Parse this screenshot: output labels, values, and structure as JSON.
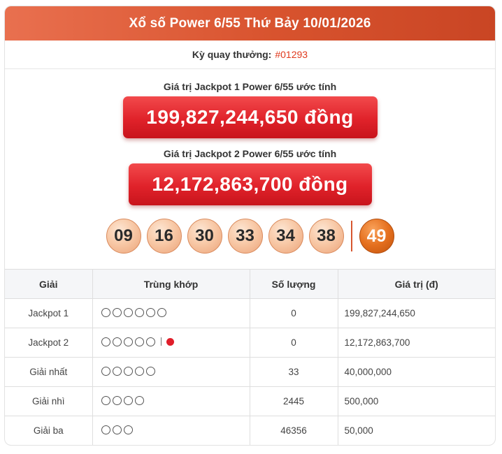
{
  "header": {
    "title": "Xổ số Power 6/55 Thứ Bảy 10/01/2026"
  },
  "draw": {
    "label": "Kỳ quay thưởng:",
    "id": "#01293"
  },
  "jackpot1": {
    "label": "Giá trị Jackpot 1 Power 6/55 ước tính",
    "value": "199,827,244,650 đồng"
  },
  "jackpot2": {
    "label": "Giá trị Jackpot 2 Power 6/55 ước tính",
    "value": "12,172,863,700 đồng"
  },
  "balls": [
    "09",
    "16",
    "30",
    "33",
    "34",
    "38"
  ],
  "power_ball": "49",
  "colors": {
    "header": "#d8532e",
    "jackpot": "#e0222a",
    "value_text": "#e03a1e",
    "power_ball": "#e5701f"
  },
  "table": {
    "headers": [
      "Giải",
      "Trùng khớp",
      "Số lượng",
      "Giá trị (đ)"
    ],
    "rows": [
      {
        "name": "Jackpot 1",
        "match_circles": 6,
        "power": false,
        "qty": "0",
        "value": "199,827,244,650"
      },
      {
        "name": "Jackpot 2",
        "match_circles": 5,
        "power": true,
        "qty": "0",
        "value": "12,172,863,700"
      },
      {
        "name": "Giải nhất",
        "match_circles": 5,
        "power": false,
        "qty": "33",
        "value": "40,000,000"
      },
      {
        "name": "Giải nhì",
        "match_circles": 4,
        "power": false,
        "qty": "2445",
        "value": "500,000"
      },
      {
        "name": "Giải ba",
        "match_circles": 3,
        "power": false,
        "qty": "46356",
        "value": "50,000"
      }
    ]
  }
}
